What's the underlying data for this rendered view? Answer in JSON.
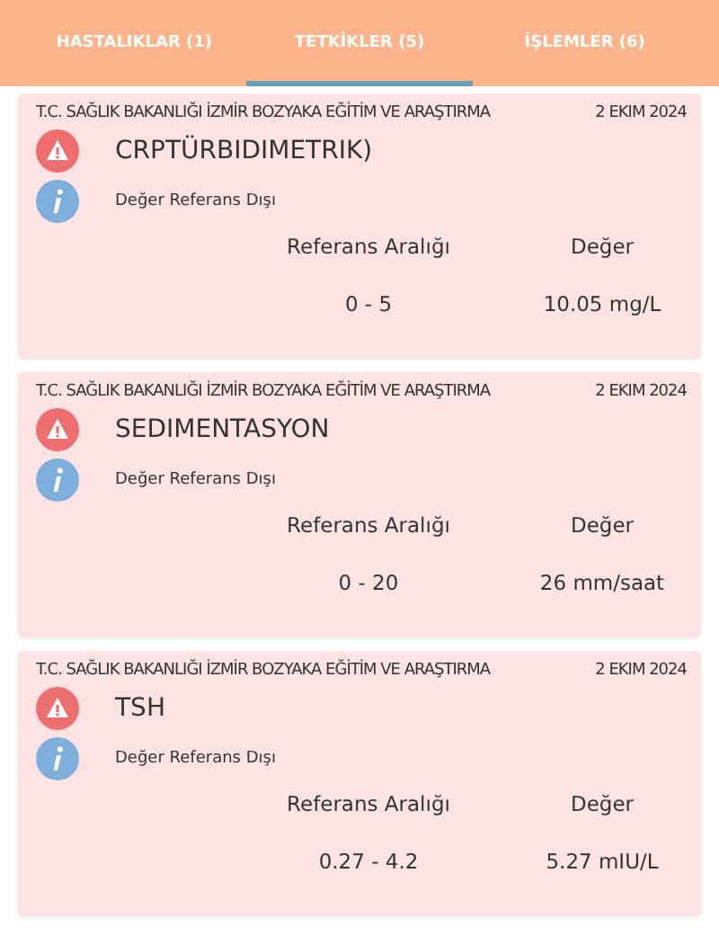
{
  "tabs": [
    {
      "label": "HASTALIKLAR (1)",
      "selected": false
    },
    {
      "label": "TETKİKLER (5)",
      "selected": true
    },
    {
      "label": "İŞLEMLER (6)",
      "selected": false
    }
  ],
  "results": [
    {
      "institution": "T.C. SAĞLIK BAKANLIĞI İZMİR BOZYAKA EĞİTİM VE ARAŞTIRMA",
      "date": "2 EKIM 2024",
      "test": "CRPTÜRBIDIMETRIK)",
      "status": "Değer Referans Dışı",
      "range_label": "Referans Aralığı",
      "value_label": "Değer",
      "range": "0 - 5",
      "value": "10.05 mg/L"
    },
    {
      "institution": "T.C. SAĞLIK BAKANLIĞI İZMİR BOZYAKA EĞİTİM VE ARAŞTIRMA",
      "date": "2 EKIM 2024",
      "test": "SEDIMENTASYON",
      "status": "Değer Referans Dışı",
      "range_label": "Referans Aralığı",
      "value_label": "Değer",
      "range": "0 - 20",
      "value": "26 mm/saat"
    },
    {
      "institution": "T.C. SAĞLIK BAKANLIĞI İZMİR BOZYAKA EĞİTİM VE ARAŞTIRMA",
      "date": "2 EKIM 2024",
      "test": "TSH",
      "status": "Değer Referans Dışı",
      "range_label": "Referans Aralığı",
      "value_label": "Değer",
      "range": "0.27 - 4.2",
      "value": "5.27 mIU/L"
    }
  ]
}
